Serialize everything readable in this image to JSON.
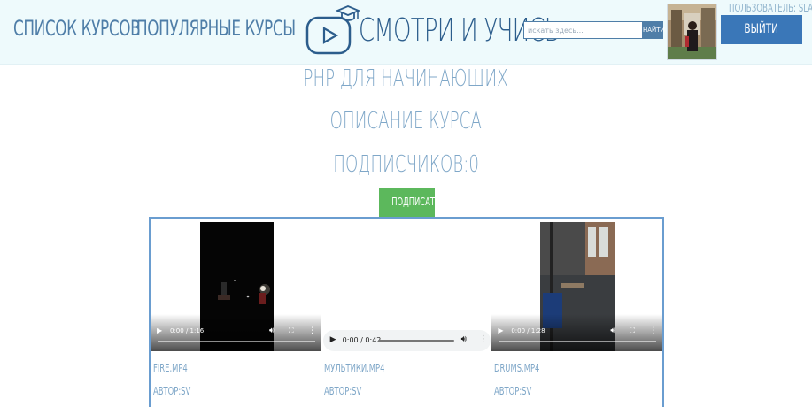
{
  "header": {
    "nav": {
      "courses_label": "СПИСОК КУРСОВ",
      "popular_label": "ПОПУЛЯРНЫЕ КУРСЫ"
    },
    "logo_text": "СМОТРИ И УЧИСЬ",
    "search": {
      "placeholder": "искать здесь...",
      "button_label": "НАЙТИ"
    },
    "user_label": "ПОЛЬЗОВАТЕЛЬ: SLAVA",
    "logout_label": "ВЫЙТИ"
  },
  "course": {
    "title": "PHP ДЛЯ НАЧИНАЮЩИХ",
    "description": "ОПИСАНИЕ КУРСА",
    "subscribers": "ПОДПИСЧИКОВ:0",
    "subscribe_label": "ПОДПИСАТЬСЯ"
  },
  "media": [
    {
      "type": "video",
      "time": "0:00 / 1:16",
      "file": "FIRE.MP4",
      "author": "АВТОР:SV"
    },
    {
      "type": "audio",
      "time": "0:00 / 0:42",
      "file": "МУЛЬТИКИ.MP4",
      "author": "АВТОР:SV"
    },
    {
      "type": "video",
      "time": "0:00 / 1:28",
      "file": "DRUMS.MP4",
      "author": "АВТОР:SV"
    }
  ],
  "icons": {
    "play": "play-icon",
    "volume": "volume-icon",
    "fullscreen": "fullscreen-icon",
    "more": "more-icon"
  },
  "colors": {
    "header_bg": "#eefafc",
    "brand_blue": "#2c5d8c",
    "link_blue": "#4f7ea8",
    "logout_bg": "#3a77b8",
    "subscribe_green": "#5cb85c",
    "muted_text": "#7fa7c8"
  }
}
